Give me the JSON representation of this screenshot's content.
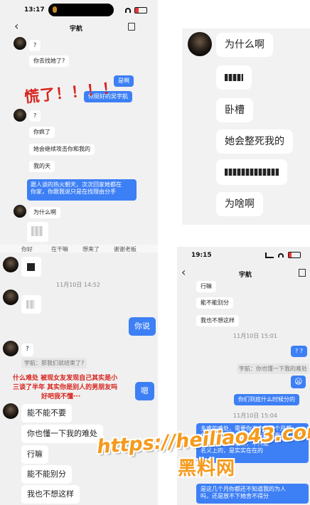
{
  "top_left": {
    "status": {
      "time": "13:17"
    },
    "header": {
      "title": "宇航",
      "back_icon": "‹",
      "more_icon": "⋮"
    },
    "messages": [
      "?",
      "你去找她了?",
      "是啊",
      "你挺好的吴宇航",
      "?",
      "你疯了",
      "她会继续攻击你和我的",
      "我的天",
      "跟人谈的热火朝天，次次回家她都在",
      "你家，你跟我说只是在找理由分手",
      "为什么啊"
    ],
    "caption": "慌了！！！！",
    "quick_replies": [
      "你好",
      "在干嘛",
      "想来了",
      "谢谢老板"
    ]
  },
  "top_right": {
    "messages": [
      "为什么啊",
      "卧槽",
      "她会整死我的",
      "为啥啊"
    ]
  },
  "bottom_left": {
    "timestamp": "11月10日 14:52",
    "messages": [
      "?",
      "你说",
      "嗯",
      "能不能不要",
      "你也懂一下我的难处",
      "行嘛",
      "能不能别分",
      "我也不想这样"
    ],
    "quote": "宇航：那我们就结束了?",
    "caption": [
      "什么难处 被现女友发现自己其实是小",
      "三谈了半年 其实你是别人的男朋友吗",
      "好吧我不懂···"
    ]
  },
  "bottom_right": {
    "status": {
      "time": "19:15"
    },
    "header": {
      "title": "宇航",
      "back_icon": "‹",
      "more_icon": "⋮"
    },
    "timestamps": [
      "11月10日 15:01",
      "11月10日 15:04"
    ],
    "messages": [
      "行嘛",
      "能不能别分",
      "我也不想这样",
      "? ?",
      "😦",
      "你们到底什么时候分的",
      "多难的难处，需要你三个月我个月都",
      "你这个人的人品，你也不知道我有",
      "没有别人的男朋友，不只是",
      "名义上的，是实实在在的",
      "是这几个月你都还不知道我的为人",
      "吗，还是放不下她舍不得分"
    ],
    "quote": "宇航：你也懂一下我的难处"
  },
  "watermark": {
    "url": "https://heiliao43.com",
    "brand": "黑料网"
  },
  "colors": {
    "bubble_blue": "#3d7ff5",
    "accent_red": "#d8221c",
    "watermark_orange": "#f59a1c"
  }
}
